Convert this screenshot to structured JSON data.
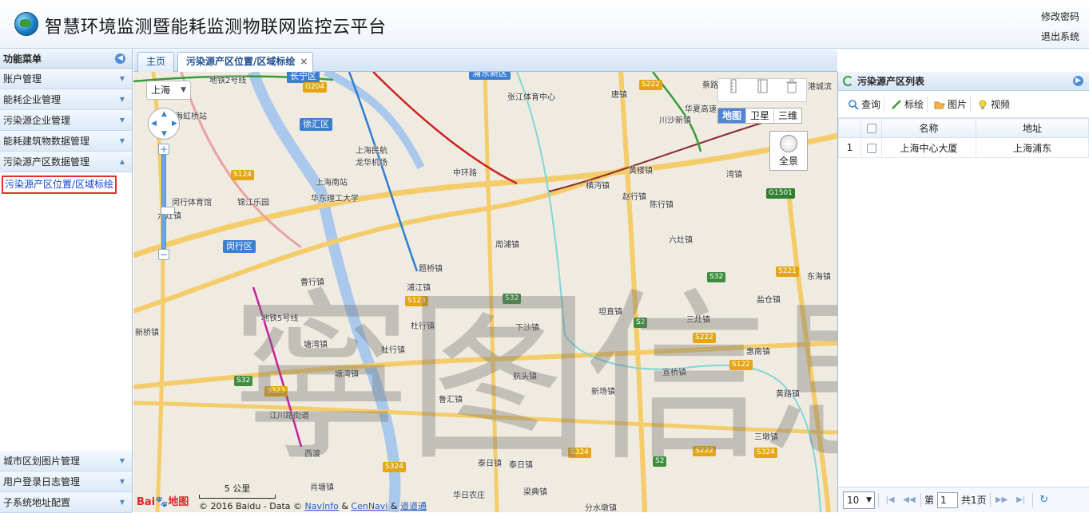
{
  "header": {
    "title": "智慧环境监测暨能耗监测物联网监控云平台",
    "change_password": "修改密码",
    "logout": "退出系统"
  },
  "sidebar": {
    "title": "功能菜单",
    "items": [
      {
        "label": "账户管理"
      },
      {
        "label": "能耗企业管理"
      },
      {
        "label": "污染源企业管理"
      },
      {
        "label": "能耗建筑物数据管理"
      },
      {
        "label": "污染源产区数据管理"
      }
    ],
    "active_subitem": "污染源产区位置/区域标绘",
    "bottom_items": [
      {
        "label": "城市区划图片管理"
      },
      {
        "label": "用户登录日志管理"
      },
      {
        "label": "子系统地址配置"
      }
    ]
  },
  "tabs": {
    "home": "主页",
    "current": "污染源产区位置/区域标绘",
    "close": "×"
  },
  "map": {
    "city": "上海",
    "zoom_level_fraction": 0.4,
    "map_types": [
      "地图",
      "卫星",
      "三维"
    ],
    "active_map_type": "地图",
    "panorama": "全景",
    "scale_label": "5 公里",
    "copyright_prefix": "© 2016 Baidu - Data ©",
    "copyright_links": [
      "NavInfo",
      "CenNavi",
      "道道通"
    ],
    "copyright_sep": "&",
    "logo_text": "Bai",
    "logo_text2": "地图",
    "watermark": "寧图信息",
    "labels": {
      "district_xuhui": "徐汇区",
      "district_minhang": "闵行区",
      "district_top": "长宁区",
      "district_pd": "浦东新区",
      "longhua": "上海民航\n龙华机场",
      "shanghai_south": "上海南站",
      "ecust": "华东理工大学",
      "minhang_stadium": "闵行体育馆",
      "jinjiang": "锦江乐园",
      "zhangjiang": "张江体育中心",
      "tangzhen": "唐镇",
      "chuansha": "川沙新镇",
      "huangqiao": "黄楼镇",
      "zhaoxiang": "赵行镇",
      "hengmian": "横沔镇",
      "chenqiao": "陈行镇",
      "wanzhen": "湾镇",
      "liuqiao": "六灶镇",
      "zhoupu": "周浦镇",
      "tiqiao": "题桥镇",
      "pujiang": "浦江镇",
      "caohang": "曹行镇",
      "xinqiao": "新桥镇",
      "tangwan": "塘湾镇",
      "tanghang": "塘湾镇",
      "zhuqiao": "杜行镇",
      "duhang": "杜行镇",
      "xiasha": "下沙镇",
      "hangtou": "航头镇",
      "kangqiao": "坦直镇",
      "sanzao": "三灶镇",
      "huinan": "惠南镇",
      "xuanqiao": "宣桥镇",
      "xinchang": "新场镇",
      "huanglu": "黄路镇",
      "yanjiao": "盐仓镇",
      "donghai": "东海镇",
      "luhui": "鲁汇镇",
      "sandun": "三墩镇",
      "tairi": "泰日镇",
      "taidang": "泰日镇",
      "xidu": "西渡",
      "jiangchuan": "江川路街道",
      "xiaoqiao": "肖塘镇",
      "huari": "华日农庄",
      "liangdian": "梁典镇",
      "fenshui": "分水墩镇",
      "caohejing": "海虹桥站",
      "nianhe": "蔡路",
      "gangcheng": "港城滨",
      "liuqiao2": "六灶镇",
      "bai": "白",
      "zhongfu": "中环路",
      "huaxiang": "华夏高速",
      "metro_lbl1": "地铁2号线",
      "metro_lbl2": "地铁5号线"
    }
  },
  "right_panel": {
    "title": "污染源产区列表",
    "toolbar": [
      "查询",
      "标绘",
      "图片",
      "视频"
    ],
    "columns": [
      "名称",
      "地址"
    ],
    "rows": [
      {
        "index": "1",
        "name": "上海中心大厦",
        "address": "上海浦东"
      }
    ],
    "pager": {
      "page_size": "10",
      "page_prefix": "第",
      "page_value": "1",
      "page_suffix": "共1页"
    }
  },
  "colors": {
    "accent": "#3c7fd0",
    "highlight_border": "#e0322c",
    "active_link": "#1a3fd0"
  }
}
